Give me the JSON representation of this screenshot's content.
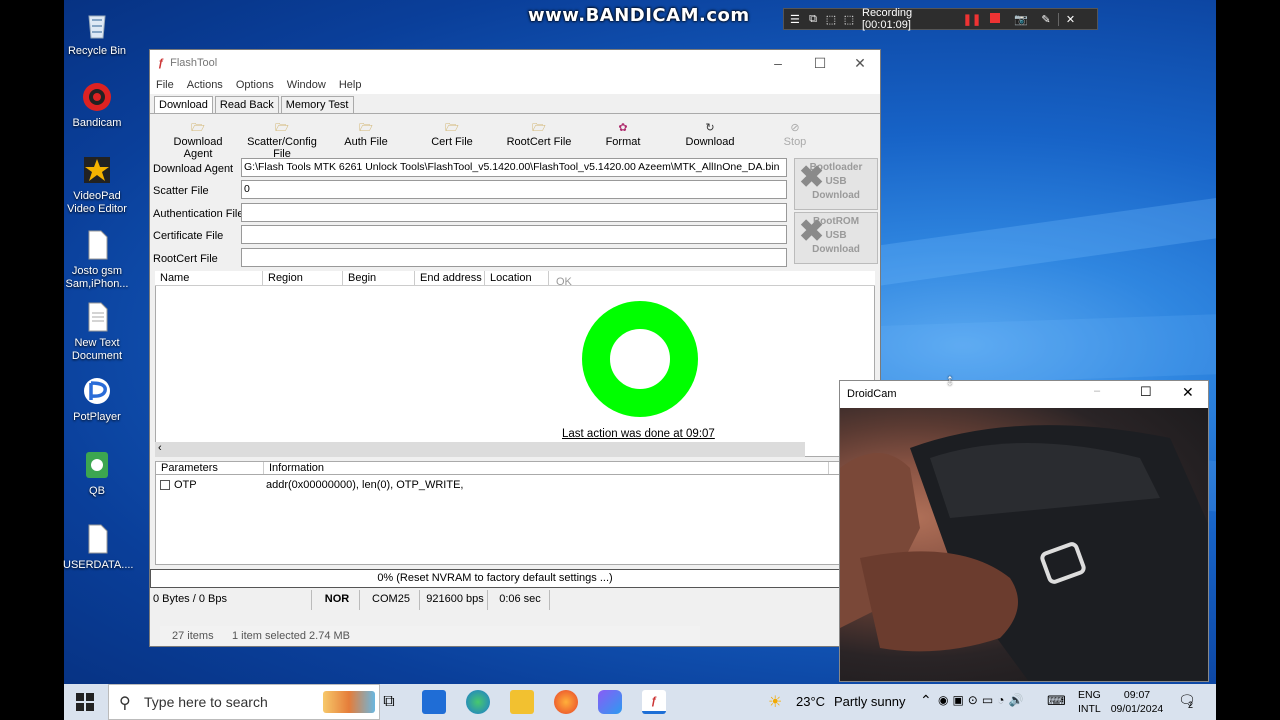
{
  "watermark": "www.BANDICAM.com",
  "recorder": {
    "status": "Recording [00:01:09]"
  },
  "desktop_icons": [
    {
      "label": "Recycle Bin",
      "icon": "recycle-bin-icon"
    },
    {
      "label": "Bandicam",
      "icon": "bandicam-icon"
    },
    {
      "label": "VideoPad Video Editor",
      "icon": "videopad-icon"
    },
    {
      "label": "Josto gsm Sam,iPhon...",
      "icon": "document-icon"
    },
    {
      "label": "New Text Document",
      "icon": "document-icon"
    },
    {
      "label": "PotPlayer",
      "icon": "potplayer-icon"
    },
    {
      "label": "QB",
      "icon": "qb-icon"
    },
    {
      "label": "USERDATA....",
      "icon": "document-icon"
    }
  ],
  "flashtool": {
    "title": "FlashTool",
    "menu": [
      "File",
      "Actions",
      "Options",
      "Window",
      "Help"
    ],
    "tabs": [
      "Download",
      "Read Back",
      "Memory Test"
    ],
    "toolbar": [
      "Download Agent",
      "Scatter/Config File",
      "Auth File",
      "Cert File",
      "RootCert File",
      "Format",
      "Download",
      "Stop"
    ],
    "fields": [
      {
        "label": "Download Agent",
        "value": "G:\\Flash Tools MTK 6261 Unlock Tools\\FlashTool_v5.1420.00\\FlashTool_v5.1420.00  Azeem\\MTK_AllInOne_DA.bin"
      },
      {
        "label": "Scatter File",
        "value": "0"
      },
      {
        "label": "Authentication File",
        "value": ""
      },
      {
        "label": "Certificate File",
        "value": ""
      },
      {
        "label": "RootCert File",
        "value": ""
      }
    ],
    "side_buttons": [
      {
        "lines": [
          "Bootloader",
          "USB",
          "Download"
        ]
      },
      {
        "lines": [
          "BootROM",
          "USB",
          "Download"
        ]
      }
    ],
    "list_columns": [
      "Name",
      "Region address",
      "Begin address",
      "End address",
      "Location"
    ],
    "ok_label": "OK",
    "last_action": "Last action was done at 09:07",
    "param_columns": [
      "Parameters",
      "Information"
    ],
    "param_rows": [
      {
        "name": "OTP",
        "info": "addr(0x00000000), len(0), OTP_WRITE,"
      }
    ],
    "progress_text": "0% (Reset NVRAM to factory default settings ...)",
    "status": {
      "bytes": "0 Bytes / 0 Bps",
      "mode": "NOR",
      "port": "COM25",
      "baud": "921600 bps",
      "time": "0:06 sec"
    }
  },
  "explorer_status": {
    "items": "27 items",
    "selected": "1 item selected  2.74 MB"
  },
  "droidcam": {
    "title": "DroidCam"
  },
  "taskbar": {
    "search_placeholder": "Type here to search",
    "weather": {
      "temp": "23°C",
      "desc": "Partly sunny"
    },
    "lang": [
      "ENG",
      "INTL"
    ],
    "time": "09:07",
    "date": "09/01/2024",
    "notifications": "2"
  }
}
